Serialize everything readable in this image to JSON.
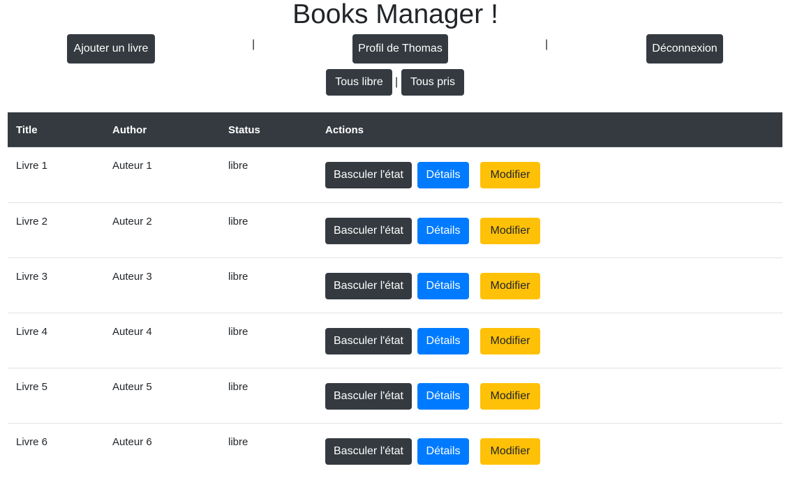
{
  "page": {
    "title": "Books Manager !"
  },
  "nav": {
    "add_book_label": "Ajouter un livre",
    "profile_label": "Profil de Thomas",
    "logout_label": "Déconnexion",
    "separator": "|"
  },
  "filters": {
    "all_free_label": "Tous libre",
    "all_taken_label": "Tous pris",
    "separator": "|"
  },
  "table": {
    "headers": {
      "title": "Title",
      "author": "Author",
      "status": "Status",
      "actions": "Actions"
    },
    "action_labels": {
      "toggle": "Basculer l'état",
      "details": "Détails",
      "edit": "Modifier"
    },
    "rows": [
      {
        "title": "Livre 1",
        "author": "Auteur 1",
        "status": "libre"
      },
      {
        "title": "Livre 2",
        "author": "Auteur 2",
        "status": "libre"
      },
      {
        "title": "Livre 3",
        "author": "Auteur 3",
        "status": "libre"
      },
      {
        "title": "Livre 4",
        "author": "Auteur 4",
        "status": "libre"
      },
      {
        "title": "Livre 5",
        "author": "Auteur 5",
        "status": "libre"
      },
      {
        "title": "Livre 6",
        "author": "Auteur 6",
        "status": "libre"
      }
    ]
  },
  "colors": {
    "dark": "#343a40",
    "primary": "#007bff",
    "warning": "#ffc107",
    "text": "#212529",
    "row_border": "#dee2e6"
  }
}
